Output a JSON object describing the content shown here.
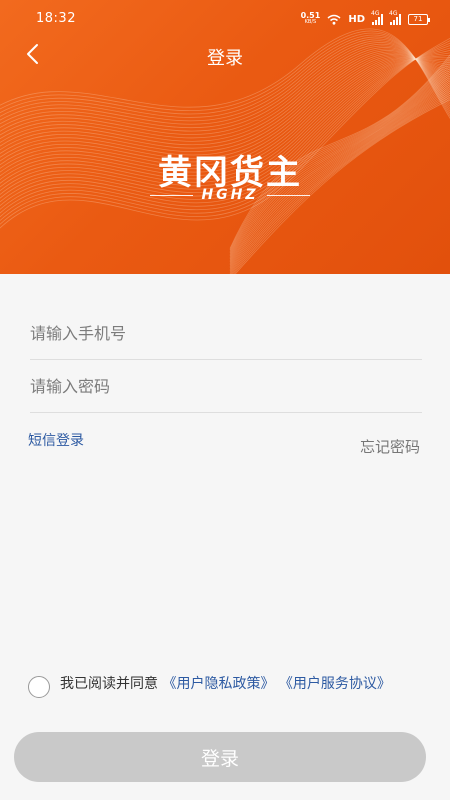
{
  "status_bar": {
    "time": "18:32",
    "net_speed": "0.51",
    "net_unit": "KB/S",
    "hd": "HD",
    "signal1_tag": "4G",
    "signal2_tag": "4G",
    "battery": "71"
  },
  "nav": {
    "title": "登录"
  },
  "logo": {
    "title_cn": "黄冈货主",
    "title_en": "HGHZ"
  },
  "form": {
    "phone_placeholder": "请输入手机号",
    "password_placeholder": "请输入密码",
    "sms_login_label": "短信登录",
    "forgot_password_label": "忘记密码"
  },
  "agreement": {
    "prefix": "我已阅读并同意",
    "privacy_link": "《用户隐私政策》",
    "service_link": "《用户服务协议》"
  },
  "login_button_label": "登录",
  "colors": {
    "brand_orange": "#ea5a12",
    "link_blue": "#2d5aa2",
    "disabled_button": "#c9c9c9"
  }
}
